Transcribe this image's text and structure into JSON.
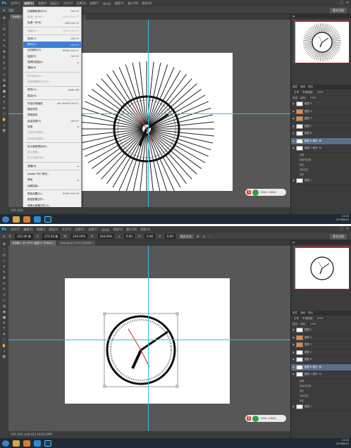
{
  "menubar": {
    "logo": "Ps",
    "items": [
      "文件(F)",
      "编辑(E)",
      "图像(I)",
      "图层(L)",
      "文字(Y)",
      "选择(S)",
      "滤镜(T)",
      "3D(D)",
      "视图(V)",
      "窗口(W)",
      "帮助(H)"
    ]
  },
  "options_bar": {
    "x": "221.00 像",
    "y": "175.50 像",
    "w": "100.00%",
    "h": "100.00%",
    "angle": "0.00",
    "h_skew": "0.00",
    "v_skew": "0.00",
    "interp": "两次立方",
    "workspace": "基本功能"
  },
  "tabs_top": [
    "未标题-1 @ 149% (图层 6 拷贝 28, RGB/8)",
    "未标题-2 @ ..."
  ],
  "tabs_bottom": [
    "未标题-1 @ 149% (图层 6, RGB/8) *",
    "long.jpg @ 119% (RGB/8) *"
  ],
  "status_top": "149.16%",
  "status_bottom": "149.16%   文档:453.1K/25.80M",
  "edit_menu": [
    {
      "label": "还原删除表示(O)",
      "shortcut": "Ctrl+Z",
      "disabled": false
    },
    {
      "label": "前进一步(W)",
      "shortcut": "Shift+Ctrl+Z",
      "disabled": true
    },
    {
      "label": "后退一步(K)",
      "shortcut": "Alt+Ctrl+Z",
      "disabled": false
    },
    {
      "sep": true
    },
    {
      "label": "渐隐(D)...",
      "shortcut": "Shift+Ctrl+F",
      "disabled": true
    },
    {
      "sep": true
    },
    {
      "label": "剪切(T)",
      "shortcut": "Ctrl+X",
      "disabled": false
    },
    {
      "label": "拷贝(C)",
      "shortcut": "Ctrl+C",
      "disabled": false,
      "highlight": true
    },
    {
      "label": "合并拷贝(Y)",
      "shortcut": "Shift+Ctrl+C",
      "disabled": false
    },
    {
      "label": "粘贴(P)",
      "shortcut": "Ctrl+V",
      "disabled": false
    },
    {
      "label": "选择性粘贴(I)",
      "shortcut": "▸",
      "disabled": false
    },
    {
      "label": "清除(E)",
      "shortcut": "",
      "disabled": false
    },
    {
      "sep": true
    },
    {
      "label": "拼写检查(H)...",
      "shortcut": "",
      "disabled": true
    },
    {
      "label": "查找和替换文本(X)...",
      "shortcut": "",
      "disabled": true
    },
    {
      "sep": true
    },
    {
      "label": "填充(L)...",
      "shortcut": "Shift+F5",
      "disabled": false
    },
    {
      "label": "描边(S)...",
      "shortcut": "",
      "disabled": false
    },
    {
      "sep": true
    },
    {
      "label": "内容识别缩放",
      "shortcut": "Alt+Shift+Ctrl+C",
      "disabled": false
    },
    {
      "label": "操控变形",
      "shortcut": "",
      "disabled": false
    },
    {
      "label": "透视变形",
      "shortcut": "",
      "disabled": false
    },
    {
      "label": "自由变换(F)",
      "shortcut": "Ctrl+T",
      "disabled": false
    },
    {
      "label": "变换",
      "shortcut": "▸",
      "disabled": false
    },
    {
      "label": "自动对齐图层...",
      "shortcut": "",
      "disabled": true
    },
    {
      "label": "自动混合图层...",
      "shortcut": "",
      "disabled": true
    },
    {
      "sep": true
    },
    {
      "label": "定义画笔预设(B)...",
      "shortcut": "",
      "disabled": false
    },
    {
      "label": "定义图案...",
      "shortcut": "",
      "disabled": true
    },
    {
      "label": "定义自定形状...",
      "shortcut": "",
      "disabled": true
    },
    {
      "sep": true
    },
    {
      "label": "清理(R)",
      "shortcut": "▸",
      "disabled": false
    },
    {
      "sep": true
    },
    {
      "label": "Adobe PDF 预设...",
      "shortcut": "",
      "disabled": false
    },
    {
      "label": "预设",
      "shortcut": "▸",
      "disabled": false
    },
    {
      "label": "远程连接...",
      "shortcut": "",
      "disabled": false
    },
    {
      "sep": true
    },
    {
      "label": "颜色设置(G)...",
      "shortcut": "Shift+Ctrl+K",
      "disabled": false
    },
    {
      "label": "指定配置文件...",
      "shortcut": "",
      "disabled": false
    },
    {
      "label": "转换为配置文件(V)...",
      "shortcut": "",
      "disabled": false
    },
    {
      "sep": true
    },
    {
      "label": "键盘快捷键...",
      "shortcut": "Alt+Shift+Ctrl+K",
      "disabled": false
    },
    {
      "label": "菜单(U)...",
      "shortcut": "Alt+Shift+Ctrl+M",
      "disabled": false
    },
    {
      "label": "首选项(N)",
      "shortcut": "▸",
      "disabled": false
    }
  ],
  "layers_panel": {
    "tabs": [
      "图层",
      "通道",
      "路径"
    ],
    "blend": "正常",
    "opacity_label": "不透明度:",
    "opacity": "100%",
    "lock_label": "锁定:",
    "fill_label": "填充:",
    "fill": "100%",
    "layers": [
      {
        "name": "图层 5",
        "orange": false
      },
      {
        "name": "图层 4",
        "orange": true
      },
      {
        "name": "图层 3",
        "orange": true
      },
      {
        "name": "图层 2",
        "orange": false
      },
      {
        "name": "图层 6",
        "orange": false
      },
      {
        "name": "图层 6 拷贝 28",
        "orange": false,
        "active": true
      },
      {
        "name": "图层 1 拷贝 10",
        "orange": false
      }
    ],
    "effects": [
      "效果",
      "斜面和浮雕",
      "描边",
      "渐变叠加",
      "投影"
    ],
    "bottom_layer": "图层 1"
  },
  "ime": {
    "brand": "S",
    "speed": "11K/s",
    "speed2": "0.8K/s"
  },
  "tray": {
    "time": "13:25",
    "date": "2016/6/14"
  },
  "taskbar_icons": [
    "start-icon",
    "explorer-icon",
    "media-icon",
    "browser-icon",
    "photoshop-icon"
  ],
  "colors": {
    "guide": "#32c0e6",
    "accent": "#3d7fd6",
    "second_hand": "#e0402a"
  }
}
